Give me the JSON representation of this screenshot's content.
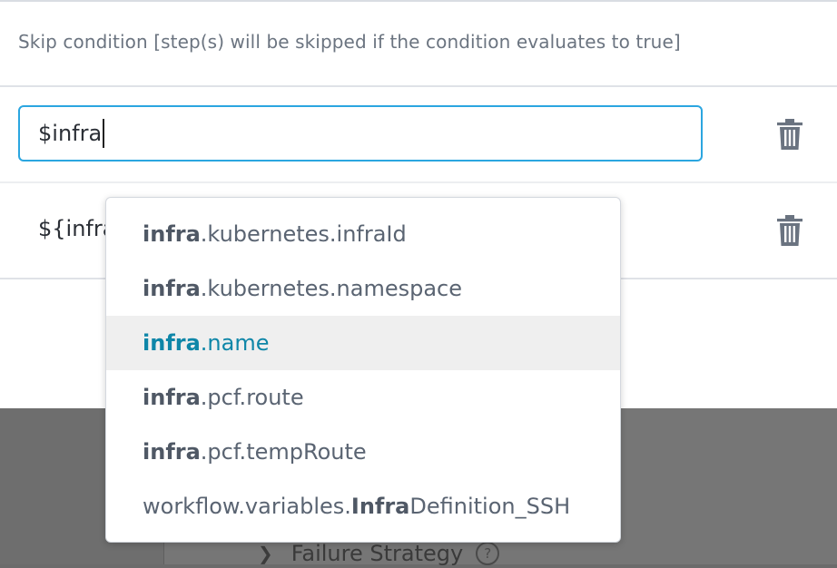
{
  "dialog": {
    "description": "Skip condition [step(s) will be skipped if the condition evaluates to true]",
    "input_value": "$infra",
    "row2_text": "${infra"
  },
  "autocomplete": {
    "options": [
      {
        "match": "infra",
        "rest": ".kubernetes.infraId",
        "prefix": "",
        "active": false
      },
      {
        "match": "infra",
        "rest": ".kubernetes.namespace",
        "prefix": "",
        "active": false
      },
      {
        "match": "infra",
        "rest": ".name",
        "prefix": "",
        "active": true
      },
      {
        "match": "infra",
        "rest": ".pcf.route",
        "prefix": "",
        "active": false
      },
      {
        "match": "infra",
        "rest": ".pcf.tempRoute",
        "prefix": "",
        "active": false
      },
      {
        "match": "Infra",
        "rest": "Definition_SSH",
        "prefix": "workflow.variables.",
        "active": false
      }
    ]
  },
  "background": {
    "failure_strategy_label": "Failure Strategy",
    "help_glyph": "?"
  },
  "icons": {
    "delete": "trash-icon",
    "chevron": "chevron-right-icon",
    "help": "help-circle-icon"
  },
  "colors": {
    "focus_border": "#2ba6e0",
    "active_option_text": "#0e86a8",
    "active_option_bg": "#efefef"
  }
}
